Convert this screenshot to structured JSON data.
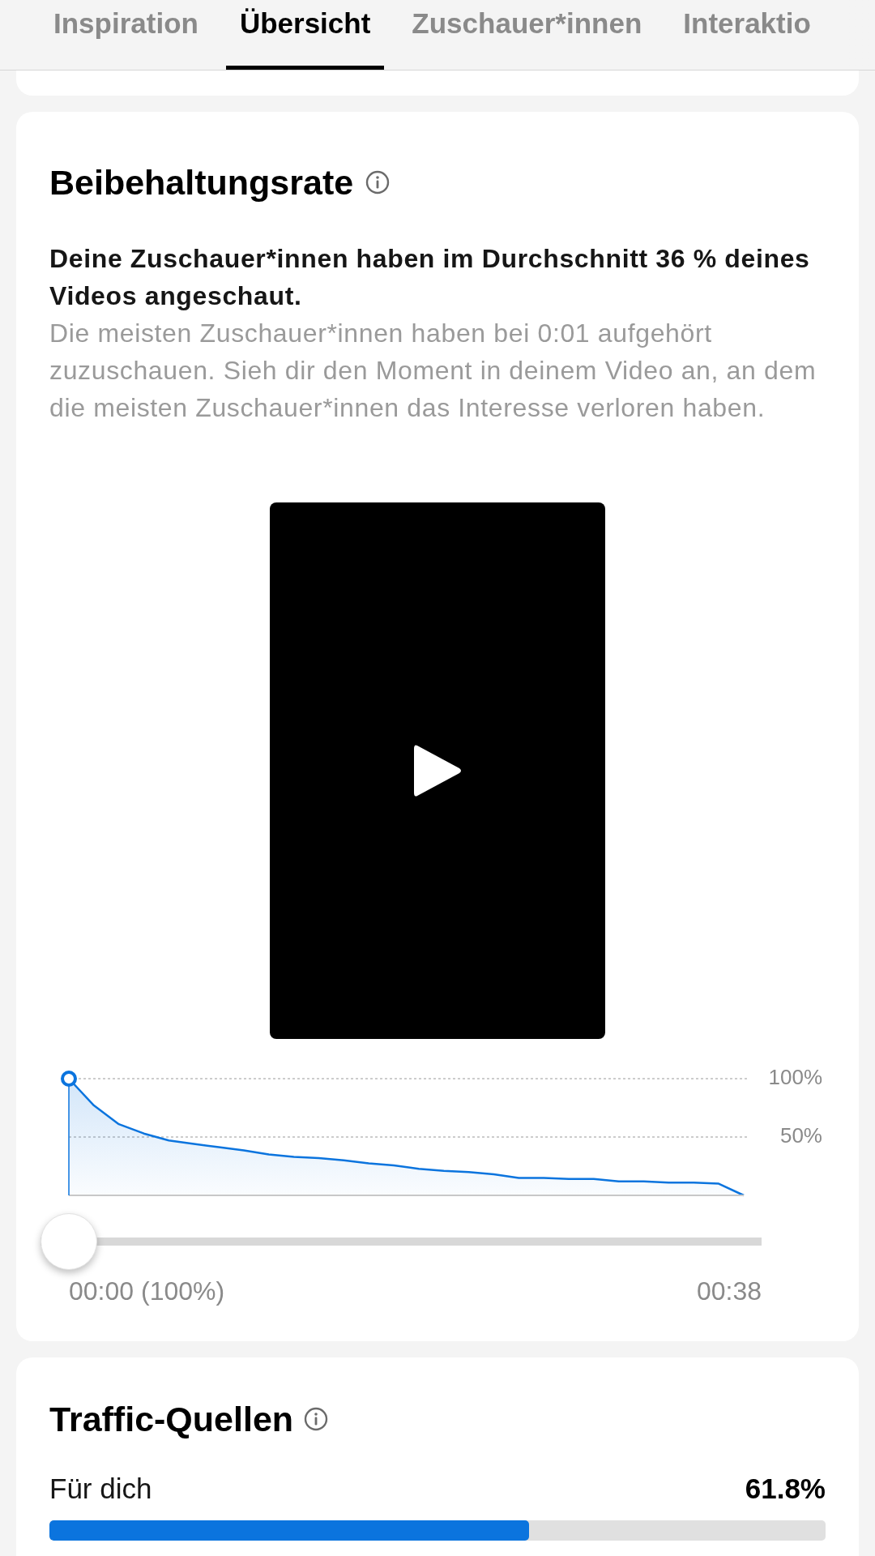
{
  "tabs": [
    {
      "label": "Inspiration",
      "selected": false
    },
    {
      "label": "Übersicht",
      "selected": true
    },
    {
      "label": "Zuschauer*innen",
      "selected": false
    },
    {
      "label": "Interaktio",
      "selected": false
    }
  ],
  "retention": {
    "title": "Beibehaltungsrate",
    "summary": "Deine Zuschauer*innen haben im Durchschnitt 36 % deines Videos angeschaut.",
    "description": "Die meisten Zuschauer*innen haben bei 0:01 aufgehört zuzuschauen. Sieh dir den Moment in deinem Video an, an dem die meisten Zuschauer*innen das Interesse verloren haben.",
    "chart_data": {
      "type": "area",
      "ylim": [
        0,
        100
      ],
      "yticks": [
        {
          "value": 50,
          "label": "50%"
        },
        {
          "value": 100,
          "label": "100%"
        }
      ],
      "categories": [
        null,
        null,
        null,
        null,
        null,
        null,
        null,
        null,
        null,
        null,
        null,
        null,
        null,
        null,
        null,
        null,
        null,
        null,
        null,
        null,
        null,
        null,
        null,
        null,
        null,
        null,
        null,
        null
      ],
      "series": [
        {
          "color": "#0b74de",
          "values": [
            100,
            77,
            61,
            53,
            47,
            44,
            41.4,
            38.6,
            35,
            33,
            32,
            30,
            27.4,
            25.6,
            22.8,
            21,
            20,
            18,
            14.9,
            14.9,
            14,
            14,
            12,
            12,
            11,
            11,
            10,
            0
          ]
        }
      ]
    },
    "slider": {
      "level": 0,
      "start_label": "00:00 (100%)",
      "end_label": "00:38"
    }
  },
  "traffic": {
    "title": "Traffic-Quellen",
    "sources": [
      {
        "name": "Für dich",
        "value": "61.8%",
        "level": 0.618
      }
    ]
  }
}
